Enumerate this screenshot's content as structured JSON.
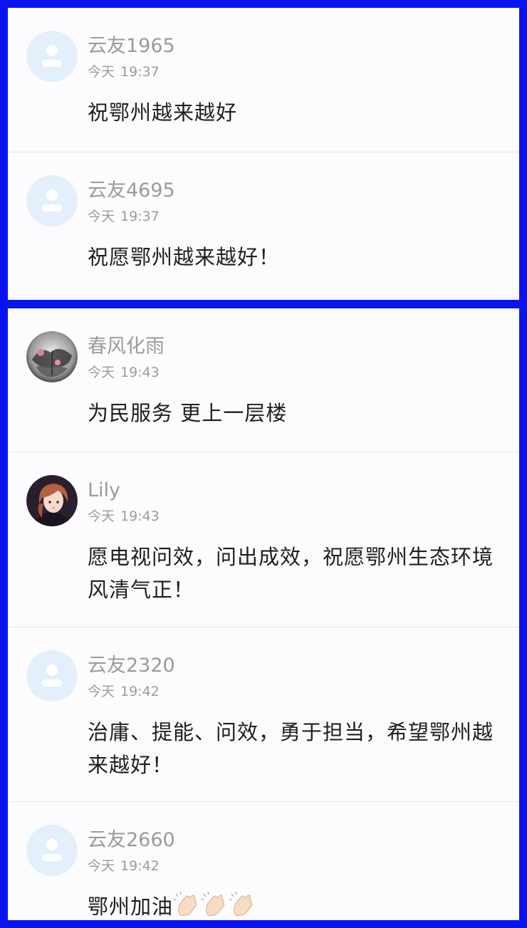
{
  "comments_top": [
    {
      "user": "云友1965",
      "day": "今天",
      "time": "19:37",
      "text": "祝鄂州越来越好",
      "avatar": "default-avatar-icon"
    },
    {
      "user": "云友4695",
      "day": "今天",
      "time": "19:37",
      "text": "祝愿鄂州越来越好！",
      "avatar": "default-avatar-icon"
    }
  ],
  "comments_bottom": [
    {
      "user": "春风化雨",
      "day": "今天",
      "time": "19:43",
      "text": "为民服务 更上一层楼",
      "avatar": "ink-painting-avatar"
    },
    {
      "user": "Lily",
      "day": "今天",
      "time": "19:43",
      "text": "愿电视问效，问出成效，祝愿鄂州生态环境风清气正！",
      "avatar": "anime-girl-avatar"
    },
    {
      "user": "云友2320",
      "day": "今天",
      "time": "19:42",
      "text": "治庸、提能、问效，勇于担当，希望鄂州越来越好！",
      "avatar": "default-avatar-icon"
    },
    {
      "user": "云友2660",
      "day": "今天",
      "time": "19:42",
      "text": "鄂州加油",
      "avatar": "default-avatar-icon",
      "emoji": "clapping-hands-icon"
    }
  ],
  "colors": {
    "frame": "#0a14f0",
    "panel": "#fcfbfd",
    "meta_text": "#9b9b9b",
    "body_text": "#1f1f1f",
    "default_avatar": "#e3effb"
  }
}
